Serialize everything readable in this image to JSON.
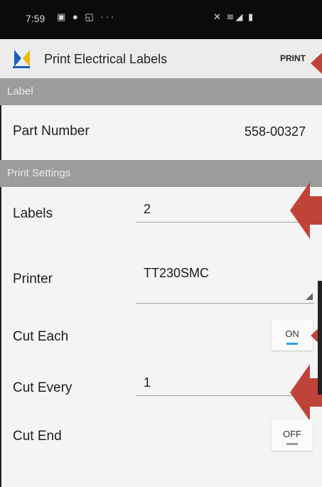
{
  "status_bar": {
    "time": "7:59",
    "left_icons": "▣ ● ◱ ···",
    "right_icons": "✕ ≋◢ ▮"
  },
  "app_bar": {
    "title": "Print Electrical Labels",
    "print_action": "PRINT",
    "logo_icon": "dk-electrical-logo"
  },
  "sections": {
    "label": "Label",
    "print_settings": "Print Settings"
  },
  "label_section": {
    "part_number_label": "Part Number",
    "part_number_value": "558-00327"
  },
  "print_settings": {
    "labels_label": "Labels",
    "labels_value": "2",
    "printer_label": "Printer",
    "printer_value": "TT230SMC",
    "cut_each_label": "Cut Each",
    "cut_each_state": "ON",
    "cut_every_label": "Cut Every",
    "cut_every_value": "1",
    "cut_end_label": "Cut End",
    "cut_end_state": "OFF"
  },
  "colors": {
    "section_header": "#9c9c9c",
    "toggle_on": "#29a7e1",
    "toggle_off": "#9e9e9e",
    "annotation_arrow": "#c0433a"
  }
}
